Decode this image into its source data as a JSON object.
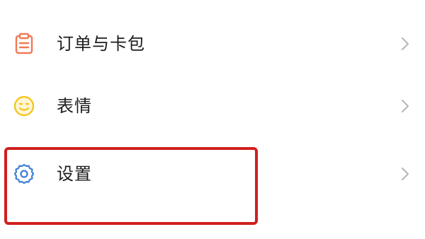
{
  "menu": {
    "items": [
      {
        "label": "订单与卡包",
        "icon": "order-card-icon",
        "icon_color": "#f07a55"
      },
      {
        "label": "表情",
        "icon": "emoji-smile-icon",
        "icon_color": "#f3c623"
      },
      {
        "label": "设置",
        "icon": "gear-icon",
        "icon_color": "#3d7fd6"
      }
    ],
    "chevron_icon": "chevron-right-icon",
    "chevron_color": "#b5b5b5"
  },
  "highlight": {
    "target": "settings",
    "color": "#d01f1f"
  }
}
